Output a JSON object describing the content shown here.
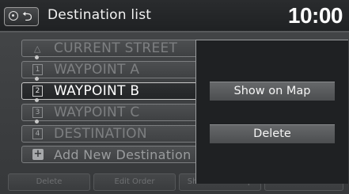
{
  "header": {
    "title": "Destination list",
    "clock": "10:00"
  },
  "list": [
    {
      "marker": "",
      "label": "CURRENT STREET",
      "active": false
    },
    {
      "marker": "1",
      "label": "WAYPOINT A",
      "active": false
    },
    {
      "marker": "2",
      "label": "WAYPOINT B",
      "active": true
    },
    {
      "marker": "3",
      "label": "WAYPOINT C",
      "active": false
    },
    {
      "marker": "4",
      "label": "DESTINATION",
      "active": false
    },
    {
      "marker": "+",
      "label": "Add New Destination",
      "active": false
    }
  ],
  "tabs": [
    "Delete",
    "Edit Order",
    "Show All on Map",
    "Start Route"
  ],
  "popup": {
    "show_on_map": "Show on Map",
    "delete": "Delete"
  }
}
